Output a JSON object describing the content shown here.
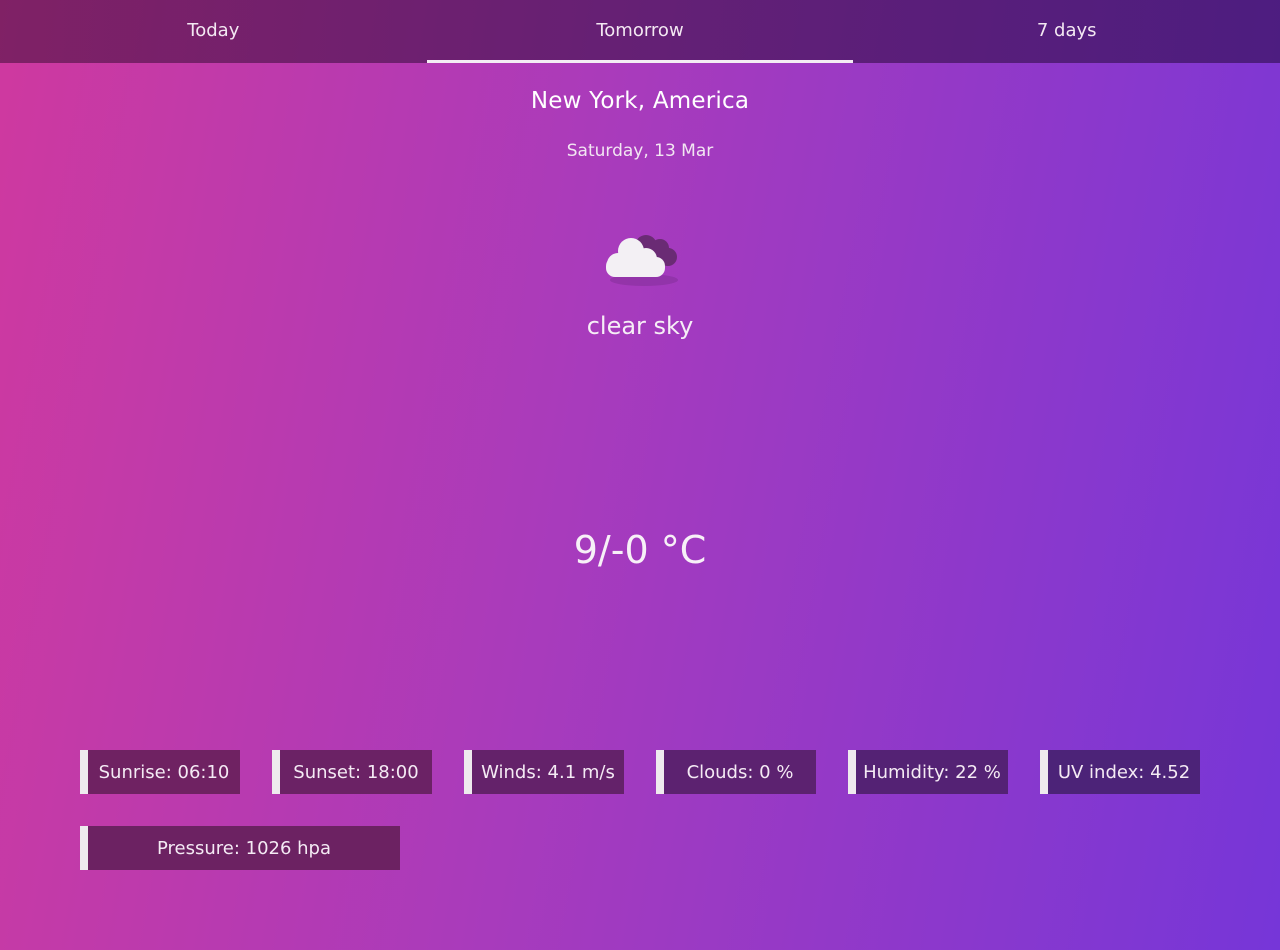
{
  "tabs": [
    {
      "label": "Today",
      "active": false
    },
    {
      "label": "Tomorrow",
      "active": true
    },
    {
      "label": "7 days",
      "active": false
    }
  ],
  "location": "New York, America",
  "date": "Saturday, 13 Mar",
  "weather": {
    "icon": "cloud-icon",
    "condition": "clear sky",
    "temperature": "9/-0 °C"
  },
  "details": {
    "sunrise": "Sunrise: 06:10",
    "sunset": "Sunset: 18:00",
    "winds": "Winds: 4.1 m/s",
    "clouds": "Clouds: 0 %",
    "humidity": "Humidity: 22 %",
    "uv_index": "UV index: 4.52",
    "pressure": "Pressure: 1026 hpa"
  },
  "colors": {
    "gradient_start": "#cf399f",
    "gradient_end": "#7636d8",
    "card_bg": "#6a2160",
    "card_accent": "#eeeaee"
  }
}
